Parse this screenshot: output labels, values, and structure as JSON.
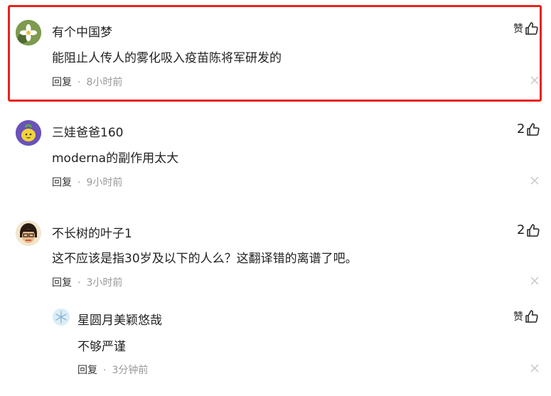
{
  "comments": [
    {
      "username": "有个中国梦",
      "text": "能阻止人传人的雾化吸入疫苗陈将军研发的",
      "reply_label": "回复",
      "separator": "·",
      "time": "8小时前",
      "like": "赞"
    },
    {
      "username": "三娃爸爸160",
      "text": "moderna的副作用太大",
      "reply_label": "回复",
      "separator": "·",
      "time": "9小时前",
      "like": "2"
    },
    {
      "username": "不长树的叶子1",
      "text": "这不应该是指30岁及以下的人么？这翻译错的离谱了吧。",
      "reply_label": "回复",
      "separator": "·",
      "time": "3小时前",
      "like": "2"
    },
    {
      "username": "星圆月美颖悠哉",
      "text": "不够严谨",
      "reply_label": "回复",
      "separator": "·",
      "time": "3分钟前",
      "like": "赞"
    }
  ],
  "colors": {
    "highlight": "#e8221b",
    "muted": "#999999",
    "text": "#222222"
  }
}
